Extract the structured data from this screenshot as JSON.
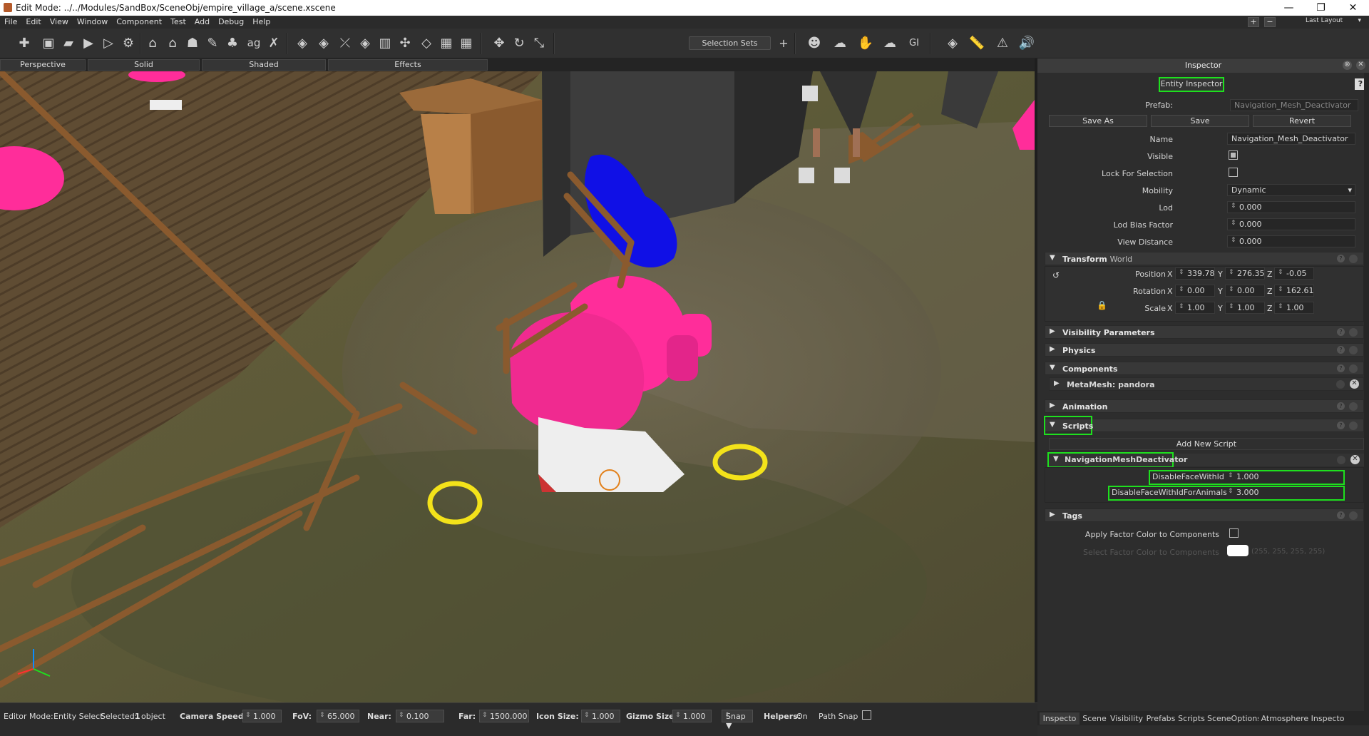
{
  "title_bar": {
    "title": "Edit Mode: ../../Modules/SandBox/SceneObj/empire_village_a/scene.xscene"
  },
  "menu": [
    "File",
    "Edit",
    "View",
    "Window",
    "Component",
    "Test",
    "Add",
    "Debug",
    "Help"
  ],
  "layout": {
    "plus": "+",
    "minus": "−",
    "selector": "Last Layout"
  },
  "toolbar": {
    "selection_sets": "Selection Sets",
    "add": "+"
  },
  "view_tabs": [
    "Perspective",
    "Solid",
    "Shaded",
    "Effects"
  ],
  "status": {
    "mode": "Editor Mode:",
    "mode_value": "Entity Select",
    "selected_label": "Selected:",
    "selected_count": "1",
    "selected_unit": "object",
    "camera_speed_label": "Camera Speed:",
    "camera_speed": "1.000",
    "fov_label": "FoV:",
    "fov": "65.000",
    "near_label": "Near:",
    "near": "0.100",
    "far_label": "Far:",
    "far": "1500.000",
    "icon_size_label": "Icon Size:",
    "icon_size": "1.000",
    "gizmo_size_label": "Gizmo Size",
    "gizmo_size": "1.000",
    "snap": "Snap ▼",
    "helpers_label": "Helpers:",
    "helpers_value": "On",
    "path_snap": "Path Snap"
  },
  "inspector": {
    "header": "Inspector",
    "tab": "Entity Inspector",
    "help": "?",
    "prefab_label": "Prefab:",
    "prefab_value": "Navigation_Mesh_Deactivator",
    "save_as": "Save As",
    "save": "Save",
    "revert": "Revert",
    "name_label": "Name",
    "name_value": "Navigation_Mesh_Deactivator",
    "visible_label": "Visible",
    "lock_label": "Lock For Selection",
    "mobility_label": "Mobility",
    "mobility_value": "Dynamic",
    "lod_label": "Lod",
    "lod_value": "0.000",
    "lod_bias_label": "Lod Bias Factor",
    "lod_bias_value": "0.000",
    "view_distance_label": "View Distance",
    "view_distance_value": "0.000",
    "transform": {
      "title": "Transform",
      "mode": "World",
      "position_label": "Position",
      "position": [
        "339.78",
        "276.35",
        "-0.05"
      ],
      "rotation_label": "Rotation",
      "rotation": [
        "0.00",
        "0.00",
        "162.61"
      ],
      "scale_label": "Scale",
      "scale": [
        "1.00",
        "1.00",
        "1.00"
      ],
      "axes": [
        "X",
        "Y",
        "Z"
      ]
    },
    "sections": {
      "visibility": "Visibility Parameters",
      "physics": "Physics",
      "components": "Components",
      "metamesh": "MetaMesh: pandora",
      "animation": "Animation",
      "scripts": "Scripts",
      "add_new_script": "Add New Script",
      "script_name": "NavigationMeshDeactivator",
      "field1_label": "DisableFaceWithId",
      "field1_value": "1.000",
      "field2_label": "DisableFaceWithIdForAnimals",
      "field2_value": "3.000",
      "tags": "Tags"
    },
    "apply_factor_label": "Apply Factor Color to Components",
    "select_factor_label": "Select Factor Color to Components",
    "factor_color_value": "(255, 255, 255, 255)",
    "bottom_tabs": [
      "Inspecto",
      "Scene",
      "Visibility",
      "Prefabs",
      "Scripts",
      "SceneOptions",
      "Atmosphere Inspecto"
    ]
  },
  "colors": {
    "highlight": "#1ee01e",
    "magenta": "#ff2d9a",
    "blue": "#1010e6",
    "yellow": "#f3e21a"
  }
}
